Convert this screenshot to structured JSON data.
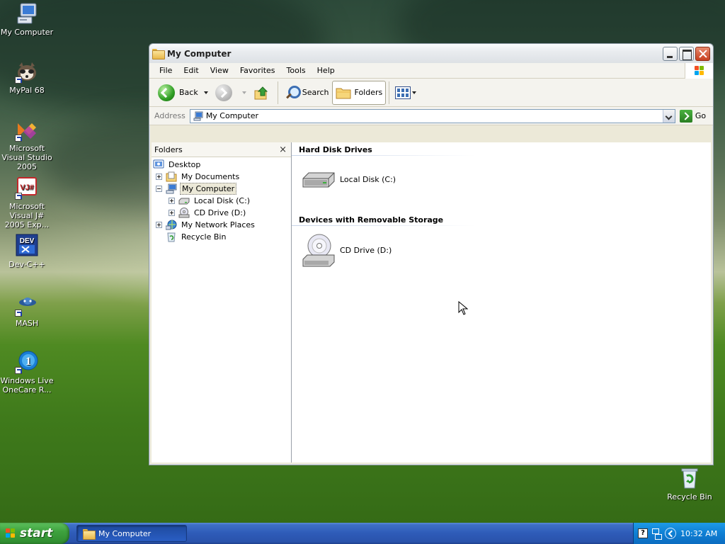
{
  "desktop": {
    "icons": [
      {
        "label": "My Computer",
        "icon": "my-computer-icon"
      },
      {
        "label": "MyPal 68",
        "icon": "mypal-icon"
      },
      {
        "label": "Microsoft Visual Studio 2005",
        "icon": "visual-studio-icon"
      },
      {
        "label": "Microsoft Visual J# 2005 Exp...",
        "icon": "visual-jsharp-icon",
        "badge": "VJ#"
      },
      {
        "label": "Dev-C++",
        "icon": "dev-cpp-icon",
        "badge": "DEV"
      },
      {
        "label": "MASH",
        "icon": "mash-icon"
      },
      {
        "label": "Windows Live OneCare R...",
        "icon": "onecare-icon"
      },
      {
        "label": "Recycle Bin",
        "icon": "recycle-bin-icon"
      }
    ]
  },
  "window": {
    "title": "My Computer",
    "menu": [
      "File",
      "Edit",
      "View",
      "Favorites",
      "Tools",
      "Help"
    ],
    "toolbar": {
      "back_label": "Back",
      "search_label": "Search",
      "folders_label": "Folders"
    },
    "address": {
      "label": "Address",
      "value": "My Computer",
      "go_label": "Go"
    },
    "folders_pane": {
      "title": "Folders",
      "close_glyph": "×",
      "tree": [
        {
          "label": "Desktop",
          "icon": "desktop-icon"
        },
        {
          "label": "My Documents",
          "icon": "my-documents-icon"
        },
        {
          "label": "My Computer",
          "icon": "my-computer-icon",
          "selected": true
        },
        {
          "label": "Local Disk (C:)",
          "icon": "hard-disk-icon"
        },
        {
          "label": "CD Drive (D:)",
          "icon": "cd-drive-icon"
        },
        {
          "label": "My Network Places",
          "icon": "network-places-icon"
        },
        {
          "label": "Recycle Bin",
          "icon": "recycle-bin-icon"
        }
      ]
    },
    "content": {
      "groups": [
        {
          "heading": "Hard Disk Drives",
          "items": [
            {
              "label": "Local Disk (C:)",
              "icon": "hard-disk-icon"
            }
          ]
        },
        {
          "heading": "Devices with Removable Storage",
          "items": [
            {
              "label": "CD Drive (D:)",
              "icon": "cd-drive-icon"
            }
          ]
        }
      ]
    }
  },
  "taskbar": {
    "start_label": "start",
    "tasks": [
      {
        "label": "My Computer",
        "icon": "folder-icon"
      }
    ],
    "tray": {
      "help_glyph": "?",
      "clock": "10:32 AM"
    }
  },
  "colors": {
    "taskbar_blue": "#2e5bb8",
    "start_green": "#3ea23e",
    "tray_blue": "#0f7fd4",
    "selection": "#ece9d8"
  }
}
